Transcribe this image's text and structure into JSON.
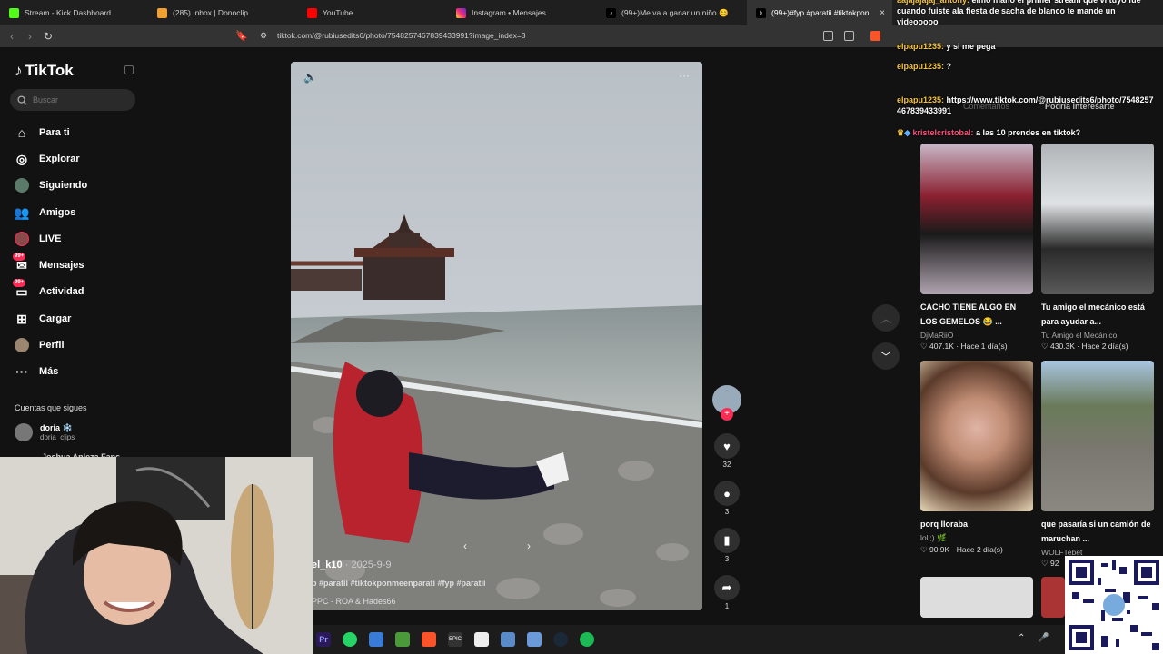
{
  "browser": {
    "tabs": [
      {
        "label": "Stream - Kick Dashboard",
        "color": "#53fc18"
      },
      {
        "label": "(285) Inbox | Donoclip",
        "color": "#f0a030"
      },
      {
        "label": "YouTube",
        "color": "#ff0000"
      },
      {
        "label": "Instagram • Mensajes",
        "color": "#d6249f"
      },
      {
        "label": "(99+)Me va a ganar un niño 😊",
        "color": "#111111"
      },
      {
        "label": "(99+)#fyp #paratii #tiktokpon",
        "color": "#111111"
      }
    ],
    "url": "tiktok.com/@rubiusedits6/photo/7548257467839433991?image_index=3",
    "close_glyph": "×"
  },
  "sidebar": {
    "logo": "TikTok",
    "search_placeholder": "Buscar",
    "items": [
      {
        "label": "Para ti",
        "icon": "home-icon"
      },
      {
        "label": "Explorar",
        "icon": "compass-icon"
      },
      {
        "label": "Siguiendo",
        "icon": "avatar-icon"
      },
      {
        "label": "Amigos",
        "icon": "friends-icon"
      },
      {
        "label": "LIVE",
        "icon": "live-icon"
      },
      {
        "label": "Mensajes",
        "icon": "messages-icon",
        "badge": "99+"
      },
      {
        "label": "Actividad",
        "icon": "activity-icon",
        "badge": "99+"
      },
      {
        "label": "Cargar",
        "icon": "upload-icon"
      },
      {
        "label": "Perfil",
        "icon": "profile-icon"
      },
      {
        "label": "Más",
        "icon": "more-icon"
      }
    ],
    "following_title": "Cuentas que sigues",
    "following": [
      {
        "name": "doria ❄️",
        "handle": "doria_clips"
      },
      {
        "name": "Joshua Anleza Fans"
      }
    ]
  },
  "video": {
    "author": "el_k10",
    "date": "2025-9-9",
    "caption": "p #paratii #tiktokponmeenparati #fyp #paratii",
    "music": "PPC - ROA & Hades66"
  },
  "actions": {
    "likes": "32",
    "comments": "3",
    "saves": "3",
    "shares": "1"
  },
  "right_panel": {
    "tab_comments": "Comentarios",
    "tab_suggested": "Podría interesarte",
    "cards": [
      {
        "title": "CACHO TIENE ALGO EN LOS GEMELOS 😂 ...",
        "author": "DjMaRiiO",
        "likes": "407.1K",
        "time": "Hace 1 día(s)"
      },
      {
        "title": "Tu amigo el mecánico está para ayudar a...",
        "author": "Tu Amigo el Mecánico",
        "likes": "430.3K",
        "time": "Hace 2 día(s)"
      },
      {
        "title": "porq lloraba",
        "author": "loli;) 🌿",
        "likes": "90.9K",
        "time": "Hace 2 día(s)"
      },
      {
        "title": "que pasaría si un camión de maruchan ...",
        "author": "WOLFTebet",
        "likes": "92",
        "time": ""
      }
    ]
  },
  "chat": [
    {
      "user": "aajajajajaj_antony",
      "text": "eimo mano el primer stream que vi tuyo fue cuando fuiste ala fiesta de sacha de blanco te mande un videooooo",
      "style": "user"
    },
    {
      "user": "elpapu1235",
      "text": "y si me pega",
      "style": "user"
    },
    {
      "user": "elpapu1235",
      "text": "?",
      "style": "user"
    },
    {
      "user": "elpapu1235",
      "text": "https://www.tiktok.com/@rubiusedits6/photo/7548257467839433991",
      "style": "user"
    },
    {
      "user": "kristelcristobal",
      "text": "a las 10 prendes en tiktok?",
      "style": "user2"
    }
  ],
  "colors": {
    "accent": "#fe2c55",
    "background": "#121212"
  }
}
